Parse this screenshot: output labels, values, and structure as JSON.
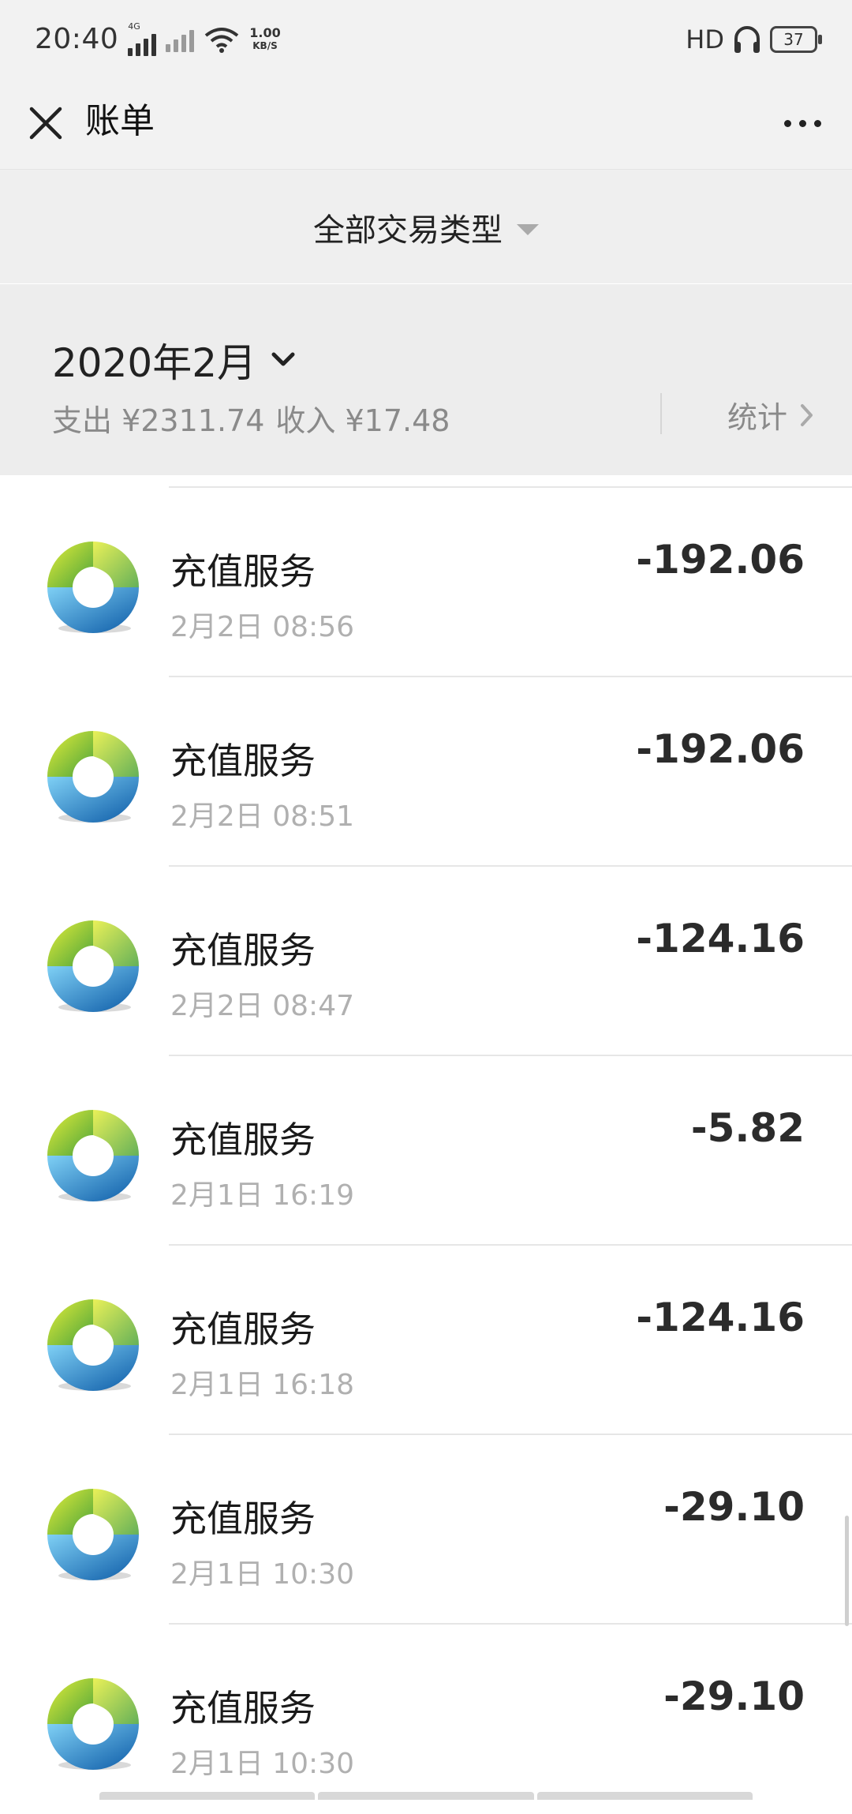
{
  "status_bar": {
    "time": "20:40",
    "network_1": "4G",
    "network_speed_top": "1.00",
    "network_speed_unit": "KB/S",
    "hd_label": "HD",
    "battery": "37"
  },
  "header": {
    "title": "账单"
  },
  "filter": {
    "label": "全部交易类型"
  },
  "month": {
    "label": "2020年2月",
    "expense_text": "支出 ¥2311.74",
    "income_text": "收入 ¥17.48",
    "stats_label": "统计"
  },
  "transactions": [
    {
      "title": "充值服务",
      "time": "2月2日 08:56",
      "amount": "-192.06"
    },
    {
      "title": "充值服务",
      "time": "2月2日 08:51",
      "amount": "-192.06"
    },
    {
      "title": "充值服务",
      "time": "2月2日 08:47",
      "amount": "-124.16"
    },
    {
      "title": "充值服务",
      "time": "2月1日 16:19",
      "amount": "-5.82"
    },
    {
      "title": "充值服务",
      "time": "2月1日 16:18",
      "amount": "-124.16"
    },
    {
      "title": "充值服务",
      "time": "2月1日 10:30",
      "amount": "-29.10"
    },
    {
      "title": "充值服务",
      "time": "2月1日 10:30",
      "amount": "-29.10"
    }
  ],
  "icons": {
    "close": "close-icon",
    "more": "more-icon",
    "dropdown": "dropdown-triangle-icon",
    "chevron_down": "chevron-down-icon",
    "chevron_right": "chevron-right-icon",
    "recharge_logo": "recharge-service-icon"
  },
  "colors": {
    "header_bg": "#f2f2f2",
    "list_bg": "#ffffff",
    "secondary_text": "#8a8a8a",
    "amount_text": "#2b2b2b",
    "logo_green": "#8cc63f",
    "logo_blue": "#1b75bc"
  }
}
